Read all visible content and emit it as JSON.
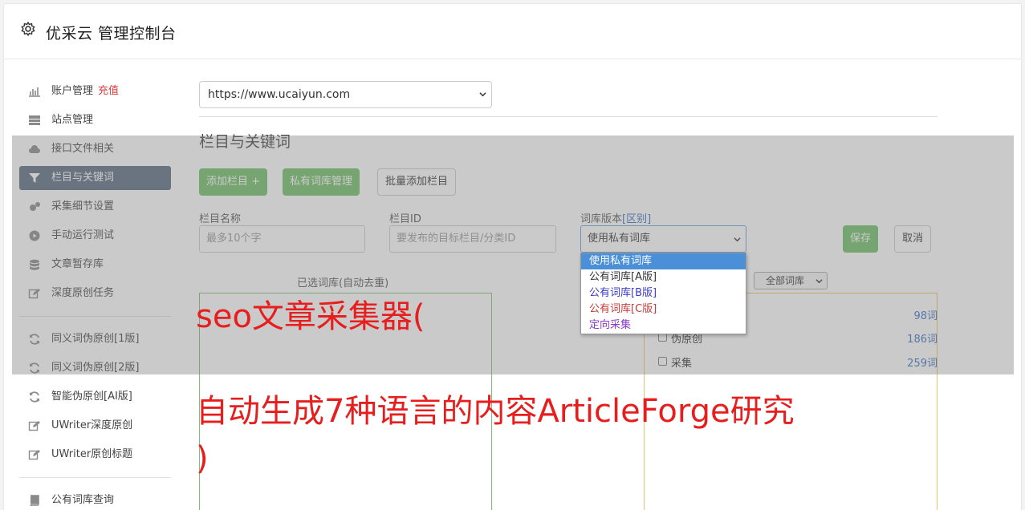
{
  "header": {
    "title": "优采云 管理控制台"
  },
  "nav": {
    "items": [
      {
        "label": "账户管理",
        "badge": "充值",
        "icon": "bar-chart-icon"
      },
      {
        "label": "站点管理",
        "icon": "server-icon"
      },
      {
        "label": "接口文件相关",
        "icon": "cloud-upload-icon"
      },
      {
        "label": "栏目与关键词",
        "icon": "filter-icon",
        "active": true
      },
      {
        "label": "采集细节设置",
        "icon": "cogs-icon"
      },
      {
        "label": "手动运行测试",
        "icon": "play-circle-icon"
      },
      {
        "label": "文章暂存库",
        "icon": "database-icon"
      },
      {
        "label": "深度原创任务",
        "icon": "edit-icon"
      },
      {
        "label": "同义词伪原创[1版]",
        "icon": "refresh-icon"
      },
      {
        "label": "同义词伪原创[2版]",
        "icon": "refresh-icon"
      },
      {
        "label": "智能伪原创[AI版]",
        "icon": "refresh-icon"
      },
      {
        "label": "UWriter深度原创",
        "icon": "edit-icon"
      },
      {
        "label": "UWriter原创标题",
        "icon": "edit-icon"
      },
      {
        "label": "公有词库查询",
        "icon": "book-icon"
      }
    ]
  },
  "main": {
    "site_select": "https://www.ucaiyun.com",
    "section_title": "栏目与关键词",
    "buttons": {
      "add_column": "添加栏目 +",
      "private_lib": "私有词库管理",
      "batch_add": "批量添加栏目",
      "save": "保存",
      "cancel": "取消"
    },
    "form": {
      "column_name_label": "栏目名称",
      "column_name_placeholder": "最多10个字",
      "column_id_label": "栏目ID",
      "column_id_placeholder": "要发布的目标栏目/分类ID",
      "lib_version_label": "词库版本",
      "lib_version_link": "[区别]",
      "lib_version_value": "使用私有词库"
    },
    "dropdown_options": [
      {
        "label": "使用私有词库",
        "color": "#ffffff"
      },
      {
        "label": "公有词库[A版]",
        "color": "#333333"
      },
      {
        "label": "公有词库[B版]",
        "color": "#3a3ad0"
      },
      {
        "label": "公有词库[C版]",
        "color": "#c83a3a"
      },
      {
        "label": "定向采集",
        "color": "#8a3ad0"
      }
    ],
    "selected_box_title": "已选词库(自动去重)",
    "filter_select": "全部词库",
    "libraries": [
      {
        "name": "",
        "count": "98词"
      },
      {
        "name": "伪原创",
        "count": "186词"
      },
      {
        "name": "采集",
        "count": "259词"
      }
    ]
  },
  "watermark": {
    "line1": "seo文章采集器(",
    "line2": "自动生成7种语言的内容ArticleForge研究",
    "line3": ")"
  }
}
